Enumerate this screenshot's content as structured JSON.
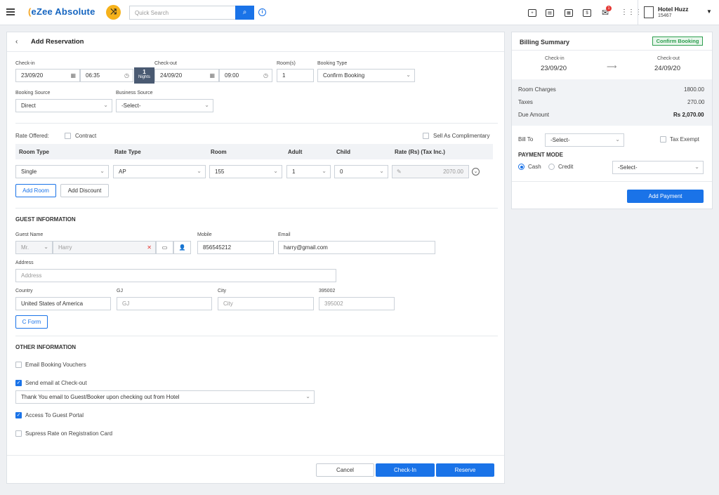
{
  "topbar": {
    "brand": "eZee Absolute",
    "search_placeholder": "Quick Search",
    "notification_count": "1",
    "hotel_name": "Hotel Huzz",
    "hotel_id": "15467"
  },
  "reservation": {
    "title": "Add Reservation",
    "checkin_label": "Check-in",
    "checkin_date": "23/09/20",
    "checkin_time": "06:35",
    "nights_count": "1",
    "nights_label": "Nights",
    "checkout_label": "Check-out",
    "checkout_date": "24/09/20",
    "checkout_time": "09:00",
    "rooms_label": "Room(s)",
    "rooms_value": "1",
    "booking_type_label": "Booking Type",
    "booking_type_value": "Confirm Booking",
    "booking_source_label": "Booking Source",
    "booking_source_value": "Direct",
    "business_source_label": "Business Source",
    "business_source_value": "-Select-",
    "rate_offered_label": "Rate Offered:",
    "contract_label": "Contract",
    "complimentary_label": "Sell As Complimentary",
    "table_headers": [
      "Room Type",
      "Rate Type",
      "Room",
      "Adult",
      "Child",
      "Rate (Rs)  (Tax Inc.)"
    ],
    "row": {
      "room_type": "Single",
      "rate_type": "AP",
      "room": "155",
      "adult": "1",
      "child": "0",
      "rate": "2070.00"
    },
    "add_room": "Add Room",
    "add_discount": "Add Discount"
  },
  "guest": {
    "section": "GUEST INFORMATION",
    "name_label": "Guest Name",
    "salutation": "Mr.",
    "name_value": "Harry",
    "mobile_label": "Mobile",
    "mobile_value": "856545212",
    "email_label": "Email",
    "email_value": "harry@gmail.com",
    "address_label": "Address",
    "address_placeholder": "Address",
    "country_label": "Country",
    "country_value": "United States of America",
    "state_label": "GJ",
    "state_placeholder": "GJ",
    "city_label": "City",
    "city_placeholder": "City",
    "zip_label": "395002",
    "zip_placeholder": "395002",
    "cform": "C Form"
  },
  "other": {
    "section": "OTHER INFORMATION",
    "email_vouchers": "Email Booking Vouchers",
    "send_email_checkout": "Send email at Check-out",
    "email_template": "Thank You email to Guest/Booker upon checking out from Hotel",
    "guest_portal": "Access To Guest Portal",
    "suppress_rate": "Supress Rate on Registration Card"
  },
  "footer": {
    "cancel": "Cancel",
    "checkin": "Check-In",
    "reserve": "Reserve"
  },
  "billing": {
    "title": "Billing Summary",
    "status": "Confirm Booking",
    "checkin_label": "Check-in",
    "checkin_date": "23/09/20",
    "checkout_label": "Check-out",
    "checkout_date": "24/09/20",
    "room_charges_label": "Room Charges",
    "room_charges": "1800.00",
    "taxes_label": "Taxes",
    "taxes": "270.00",
    "due_label": "Due Amount",
    "due": "Rs 2,070.00",
    "bill_to_label": "Bill To",
    "bill_to_value": "-Select-",
    "tax_exempt": "Tax Exempt",
    "payment_mode": "PAYMENT MODE",
    "cash": "Cash",
    "credit": "Credit",
    "payment_select": "-Select-",
    "add_payment": "Add Payment"
  },
  "colors": {
    "accent": "#1a73e8",
    "status_green": "#2e9e4f"
  }
}
